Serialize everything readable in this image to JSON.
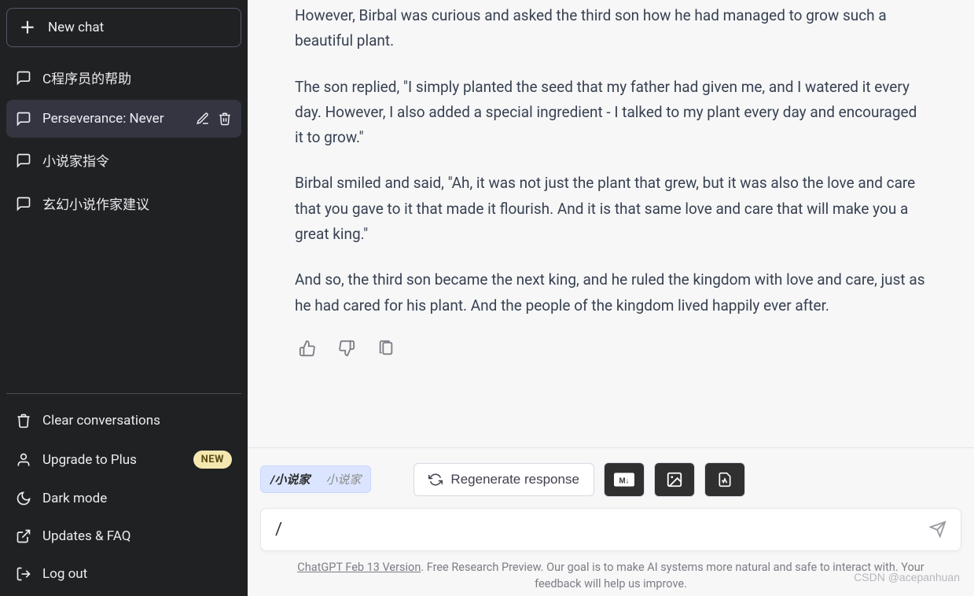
{
  "sidebar": {
    "new_chat_label": "New chat",
    "conversations": [
      {
        "label": "C程序员的帮助",
        "active": false
      },
      {
        "label": "Perseverance: Never",
        "active": true
      },
      {
        "label": "小说家指令",
        "active": false
      },
      {
        "label": "玄幻小说作家建议",
        "active": false
      }
    ],
    "menu": {
      "clear": "Clear conversations",
      "upgrade": "Upgrade to Plus",
      "upgrade_badge": "NEW",
      "dark": "Dark mode",
      "faq": "Updates & FAQ",
      "logout": "Log out"
    }
  },
  "message": {
    "paragraphs": [
      "However, Birbal was curious and asked the third son how he had managed to grow such a beautiful plant.",
      "The son replied, \"I simply planted the seed that my father had given me, and I watered it every day. However, I also added a special ingredient - I talked to my plant every day and encouraged it to grow.\"",
      "Birbal smiled and said, \"Ah, it was not just the plant that grew, but it was also the love and care that you gave to it that made it flourish. And it is that same love and care that will make you a great king.\"",
      "And so, the third son became the next king, and he ruled the kingdom with love and care, just as he had cared for his plant. And the people of the kingdom lived happily ever after."
    ]
  },
  "composer": {
    "suggestion_match": "/小说家",
    "suggestion_hint": "小说家",
    "regenerate": "Regenerate response",
    "input_value": "/"
  },
  "footer": {
    "version_label": "ChatGPT Feb 13 Version",
    "rest": ". Free Research Preview. Our goal is to make AI systems more natural and safe to interact with. Your feedback will help us improve."
  },
  "watermark": "CSDN @acepanhuan"
}
